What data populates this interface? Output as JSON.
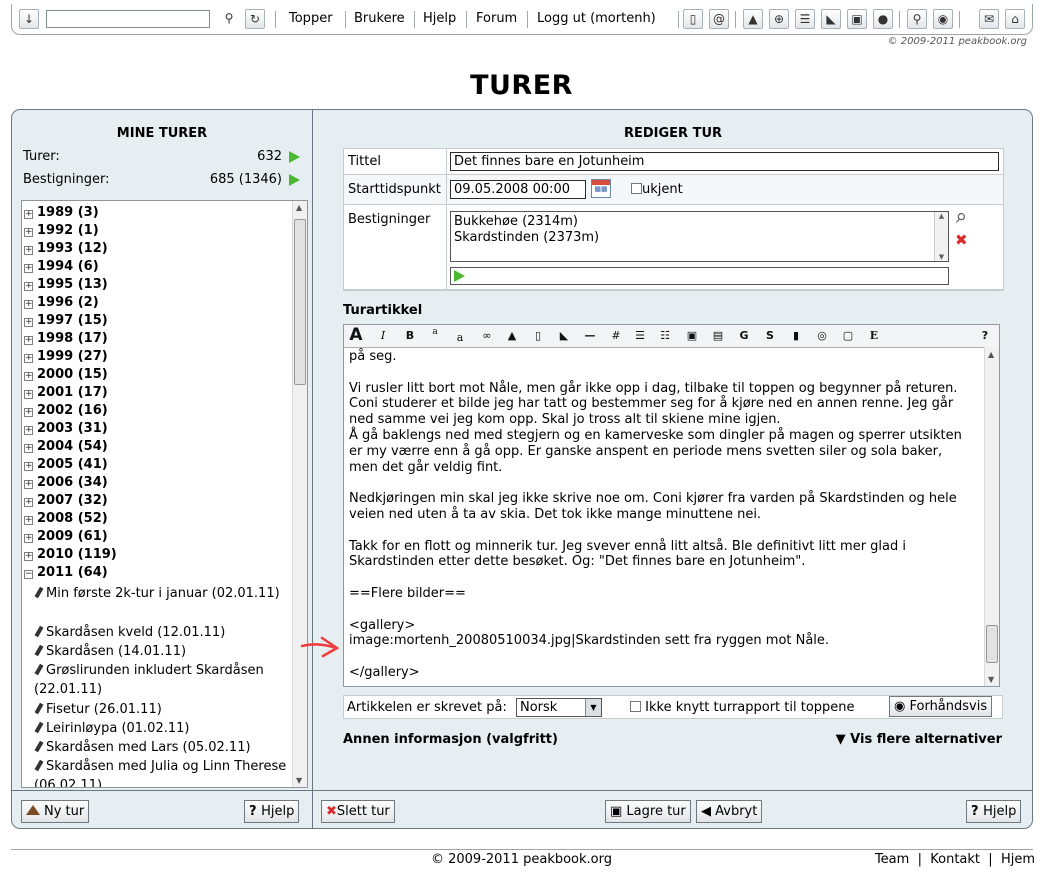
{
  "topbar": {
    "search_value": "",
    "links": [
      "Topper",
      "Brukere",
      "Hjelp",
      "Forum",
      "Logg ut (mortenh)"
    ],
    "copyright": "© 2009-2011 peakbook.org"
  },
  "page": {
    "title": "TURER"
  },
  "left": {
    "heading": "MINE TURER",
    "stats": [
      {
        "label": "Turer:",
        "value": "632"
      },
      {
        "label": "Bestigninger:",
        "value": "685 (1346)"
      }
    ],
    "years": [
      "1989 (3)",
      "1992 (1)",
      "1993 (12)",
      "1994 (6)",
      "1995 (13)",
      "1996 (2)",
      "1997 (15)",
      "1998 (17)",
      "1999 (27)",
      "2000 (15)",
      "2001 (17)",
      "2002 (16)",
      "2003 (31)",
      "2004 (54)",
      "2005 (41)",
      "2006 (34)",
      "2007 (32)",
      "2008 (52)",
      "2009 (61)",
      "2010 (119)"
    ],
    "expanded_year": "2011 (64)",
    "trips": [
      {
        "name": "Min første 2k-tur i januar",
        "date": "(02.01.11)"
      },
      {
        "name": "Skardåsen kveld",
        "date": "(12.01.11)"
      },
      {
        "name": "Skardåsen",
        "date": "(14.01.11)"
      },
      {
        "name": "Grøslirunden inkludert Skardåsen",
        "date": "(22.01.11)"
      },
      {
        "name": "Fisetur",
        "date": "(26.01.11)"
      },
      {
        "name": "Leirinløypa",
        "date": "(01.02.11)"
      },
      {
        "name": "Skardåsen med Lars",
        "date": "(05.02.11)"
      },
      {
        "name": "Skardåsen med Julia og Linn Therese",
        "date": "(06.02.11)"
      }
    ],
    "buttons": {
      "new_trip": "Ny tur",
      "help": "Hjelp"
    }
  },
  "right": {
    "heading": "REDIGER TUR",
    "form": {
      "title_label": "Tittel",
      "title_value": "Det finnes bare en Jotunheim",
      "start_label": "Starttidspunkt",
      "start_value": "09.05.2008 00:00",
      "unknown_label": "ukjent",
      "ascents_label": "Bestigninger",
      "ascents": [
        "Bukkehøe (2314m)",
        "Skardstinden (2373m)"
      ]
    },
    "article_label": "Turartikkel",
    "toolbar": {
      "italic": "I",
      "bold": "B",
      "superscript": "a",
      "subscript": "a",
      "g_label": "G",
      "s_label": "S",
      "e_label": "E",
      "help": "?"
    },
    "article_text": "på seg.\n\nVi rusler litt bort mot Nåle, men går ikke opp i dag, tilbake til toppen og begynner på returen.\nConi studerer et bilde jeg har tatt og bestemmer seg for å kjøre ned en annen renne. Jeg går\nned samme vei jeg kom opp. Skal jo tross alt til skiene mine igjen.\nÅ gå baklengs ned med stegjern og en kamerveske som dingler på magen og sperrer utsikten\ner my værre enn å gå opp. Er ganske anspent en periode mens svetten siler og sola baker,\nmen det går veldig fint.\n\nNedkjøringen min skal jeg ikke skrive noe om. Coni kjører fra varden på Skardstinden og hele\nveien ned uten å ta av skia. Det tok ikke mange minuttene nei.\n\nTakk for en flott og minnerik tur. Jeg svever ennå litt altså. Ble definitivt litt mer glad i\nSkardstinden etter dette besøket. Og: \"Det finnes bare en Jotunheim\".\n\n==Flere bilder==\n\n<gallery>\nimage:mortenh_20080510034.jpg|Skardstinden sett fra ryggen mot Nåle.\n\n</gallery>",
    "language_label": "Artikkelen er skrevet på:",
    "language_value": "Norsk",
    "no_link_label": "Ikke knytt turrapport til toppene",
    "preview_label": "Forhåndsvis",
    "other_info": "Annen informasjon (valgfritt)",
    "more_options": "Vis flere alternativer",
    "buttons": {
      "delete": "Slett tur",
      "save": "Lagre tur",
      "cancel": "Avbryt",
      "help": "Hjelp"
    }
  },
  "footer": {
    "copyright": "© 2009-2011 peakbook.org",
    "links": [
      "Team",
      "Kontakt",
      "Hjem"
    ]
  },
  "colors": {
    "accent_green": "#4cb830",
    "delete_red": "#d92b2b",
    "panel_bg": "#e6eef1"
  }
}
